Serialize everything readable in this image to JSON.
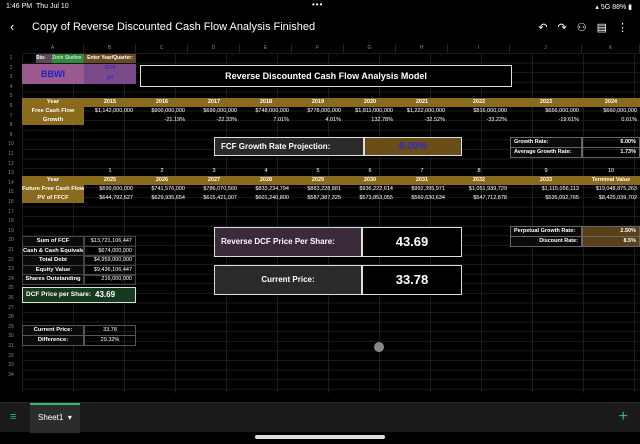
{
  "status": {
    "time": "1:46 PM",
    "date": "Thu Jul 10",
    "dots": "•••",
    "signal": "5G",
    "battery": "88%"
  },
  "header": {
    "title": "Copy of Reverse Discounted Cash Flow Analysis Finished"
  },
  "columns": [
    "A",
    "B",
    "C",
    "D",
    "E",
    "F",
    "G",
    "H",
    "I",
    "J",
    "K"
  ],
  "rows": [
    "1",
    "2",
    "3",
    "4",
    "5",
    "6",
    "7",
    "8",
    "9",
    "10",
    "11",
    "12",
    "13",
    "14",
    "15",
    "16",
    "17",
    "18",
    "19",
    "20",
    "21",
    "22",
    "23",
    "24",
    "25",
    "26",
    "27",
    "28",
    "29",
    "30",
    "31",
    "32",
    "33",
    "34"
  ],
  "top": {
    "sto": "Sto-",
    "author": "Zerin Skelton",
    "enter": "Enter Year/Quarter:",
    "ticker": "BBWI",
    "yq1": "2024",
    "yq2": "Q4",
    "title": "Reverse Discounted Cash Flow Analysis Model"
  },
  "hist": {
    "labels": [
      "Year",
      "Free Cash Flow",
      "Growth"
    ],
    "years": [
      "2015",
      "2016",
      "2017",
      "2018",
      "2019",
      "2020",
      "2021",
      "2022",
      "2023",
      "2024"
    ],
    "fcf": [
      "$1,142,000,000",
      "$900,000,000",
      "$699,000,000",
      "$748,000,000",
      "$778,000,000",
      "$1,811,000,000",
      "$1,222,000,000",
      "$816,000,000",
      "$656,000,000",
      "$660,000,000"
    ],
    "growth": [
      "",
      "-21.19%",
      "-22.33%",
      "7.01%",
      "4.01%",
      "132.78%",
      "-32.52%",
      "-33.22%",
      "-19.61%",
      "0.61%"
    ]
  },
  "growth_box": {
    "gr_label": "Growth Rate:",
    "gr_value": "6.00%",
    "agr_label": "Average Growth Rate:",
    "agr_value": "1.73%"
  },
  "projection": {
    "label": "FCF Growth Rate Projection:",
    "value": "6.00%"
  },
  "proj": {
    "idx": [
      "1",
      "2",
      "3",
      "4",
      "5",
      "6",
      "7",
      "8",
      "9",
      "10"
    ],
    "labels": [
      "Year",
      "Future Free Cash Flows",
      "PV of FFCF"
    ],
    "years": [
      "2025",
      "2026",
      "2027",
      "2028",
      "2029",
      "2030",
      "2031",
      "2032",
      "2033",
      "Terminal Value"
    ],
    "ffcf": [
      "$699,600,000",
      "$741,576,000",
      "$786,070,560",
      "$833,234,794",
      "$883,228,881",
      "$936,222,614",
      "$992,395,971",
      "$1,051,939,729",
      "$1,115,056,113",
      "$19,048,875,263"
    ],
    "pv": [
      "$644,792,627",
      "$629,935,654",
      "$615,421,007",
      "$601,240,800",
      "$587,387,325",
      "$573,853,055",
      "$560,630,634",
      "$547,712,878",
      "$535,092,765",
      "$8,425,039,702"
    ]
  },
  "rates": {
    "pg_label": "Perpetual Growth Rate:",
    "pg_value": "2.50%",
    "dr_label": "Discount Rate:",
    "dr_value": "8.5%"
  },
  "summary": {
    "labels": [
      "Sum of FCF",
      "Cash & Cash Equivalents",
      "Total Debt",
      "Equity Value",
      "Shares Outstanding"
    ],
    "values": [
      "$13,721,106,447",
      "$674,000,000",
      "$4,959,000,000",
      "$9,436,106,447",
      "216,000,000"
    ],
    "dcf_label": "DCF Price per Share:",
    "dcf_value": "43.69"
  },
  "reverse": {
    "label": "Reverse DCF Price Per Share:",
    "value": "43.69"
  },
  "current": {
    "label": "Current Price:",
    "value": "33.78"
  },
  "diff": {
    "cp_label": "Current Price:",
    "cp_value": "33.78",
    "d_label": "Difference:",
    "d_value": "29.32%"
  },
  "footer": {
    "sheet": "Sheet1"
  },
  "colors": {
    "gold": "#8a6a1c",
    "purple_box": "#3b2a3a",
    "green_box": "#163a1e",
    "accent": "#2fbf5f",
    "blue_text": "#2b2bd6"
  }
}
